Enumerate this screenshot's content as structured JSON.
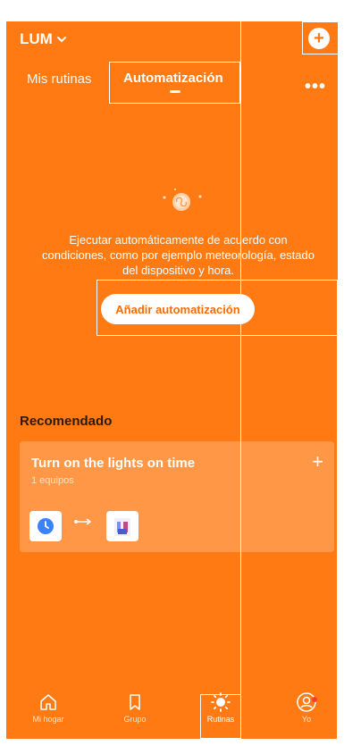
{
  "header": {
    "home_name": "LUM"
  },
  "tabs": [
    {
      "label": "Mis rutinas",
      "active": false
    },
    {
      "label": "Automatización",
      "active": true
    }
  ],
  "more_label": "•••",
  "empty_state": {
    "text": "Ejecutar automáticamente de acuerdo con condiciones, como por ejemplo meteorología, estado del dispositivo y hora.",
    "button_label": "Añadir automatización"
  },
  "recommended": {
    "title": "Recomendado",
    "card": {
      "title": "Turn on the lights on time",
      "subtitle": "1 equipos",
      "plus_label": "+"
    }
  },
  "bottom_nav": [
    {
      "label": "Mi hogar",
      "icon": "home-icon",
      "active": false
    },
    {
      "label": "Grupo",
      "icon": "bookmark-icon",
      "active": false
    },
    {
      "label": "Rutinas",
      "icon": "sun-icon",
      "active": true
    },
    {
      "label": "Yo",
      "icon": "profile-icon",
      "active": false,
      "badge": true
    }
  ],
  "colors": {
    "primary": "#ff7a12",
    "white": "#ffffff",
    "accent_text": "#ff6a00"
  }
}
